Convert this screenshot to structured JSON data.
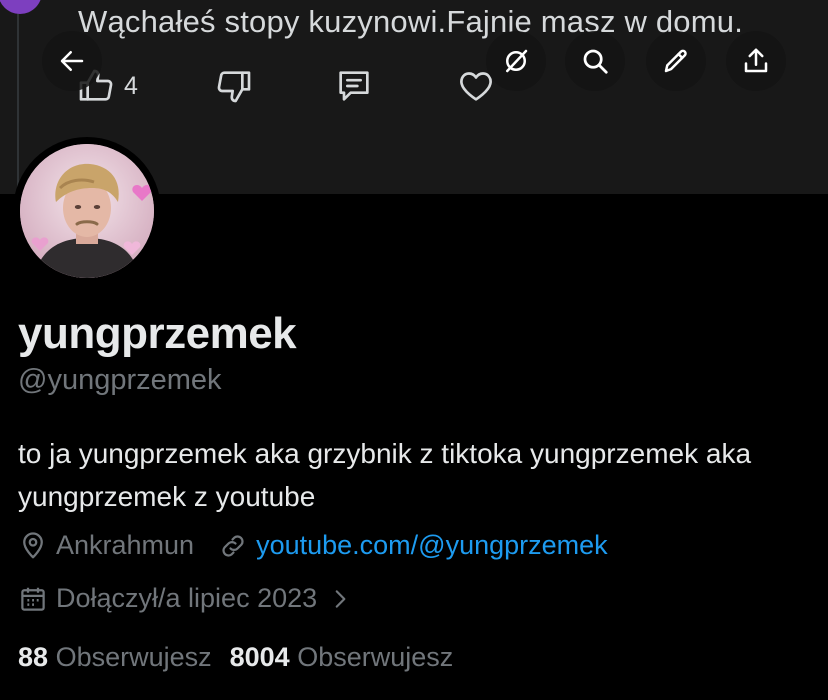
{
  "banner": {
    "post_text": "Wąchałeś stopy kuzynowi.Fajnie masz w domu.",
    "like_count": "4"
  },
  "header": {
    "icons": [
      "back-arrow-icon",
      "grok-icon",
      "search-icon",
      "edit-icon",
      "share-icon"
    ]
  },
  "profile": {
    "display_name": "yungprzemek",
    "handle": "@yungprzemek",
    "bio": "to ja yungprzemek aka grzybnik z tiktoka yungprzemek aka yungprzemek z youtube",
    "location": "Ankrahmun",
    "website": "youtube.com/@yungprzemek",
    "joined": "Dołączył/a lipiec 2023",
    "following_count": "88",
    "following_label": "Obserwujesz",
    "followers_count": "8004",
    "followers_label": "Obserwujesz"
  },
  "colors": {
    "background": "#000000",
    "banner": "#181818",
    "text_primary": "#e7e9ea",
    "text_secondary": "#71767b",
    "link": "#1d9bf0",
    "peek_avatar": "#7d3fbf"
  }
}
